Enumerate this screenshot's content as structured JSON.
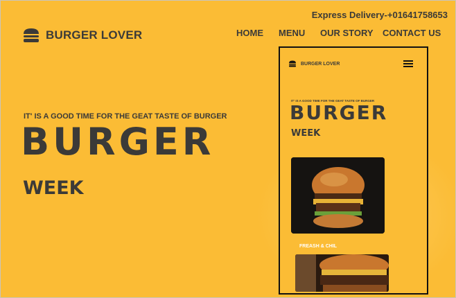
{
  "header": {
    "delivery": "Express Delivery-+01641758653",
    "brand": "BURGER LOVER",
    "nav": [
      {
        "label": "HOME"
      },
      {
        "label": "MENU"
      },
      {
        "label": "OUR STORY"
      },
      {
        "label": "CONTACT US"
      }
    ]
  },
  "hero": {
    "tagline": "IT' IS A GOOD TIME FOR THE GEAT TASTE OF BURGER",
    "headline": "BURGER",
    "subheadline": "WEEK"
  },
  "mobile_preview": {
    "brand": "BURGER LOVER",
    "tagline": "IT' IS A GOOD TIME FOR THE GEAT TASTE OF BURGER",
    "headline": "BURGER",
    "subheadline": "WEEK",
    "card_caption": "FREASH & CHIL"
  },
  "colors": {
    "background": "#fbbc35",
    "text": "#3b3a38",
    "phone_border": "#111111"
  },
  "icons": [
    "burger-icon",
    "hamburger-menu-icon"
  ]
}
